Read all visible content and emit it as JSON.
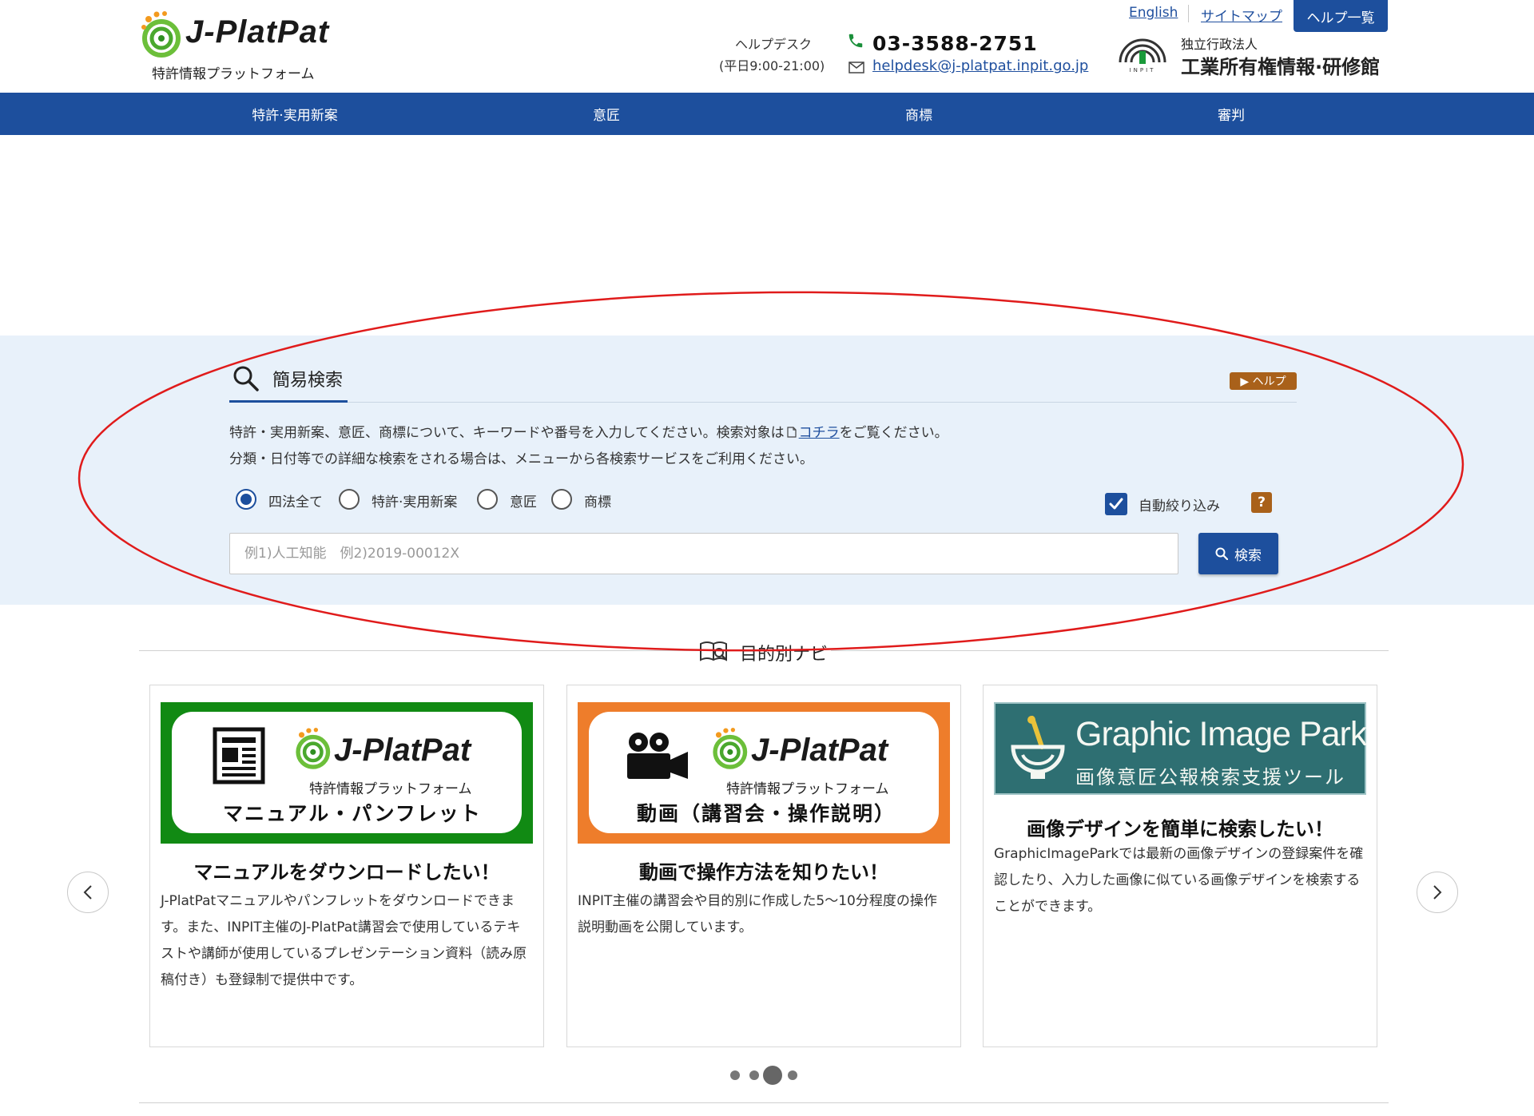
{
  "header": {
    "logo_text": "J-PlatPat",
    "logo_subtitle": "特許情報プラットフォーム",
    "helpdesk_label": "ヘルプデスク",
    "helpdesk_hours": "(平日9:00-21:00)",
    "phone": "03-3588-2751",
    "email": "helpdesk@j-platpat.inpit.go.jp",
    "links": {
      "english": "English",
      "sitemap": "サイトマップ",
      "help": "ヘルプ一覧"
    },
    "org_small": "独立行政法人",
    "org_name": "工業所有権情報·研修館",
    "org_mark_label": "INPIT"
  },
  "nav": {
    "items": [
      "特許·実用新案",
      "意匠",
      "商標",
      "審判"
    ]
  },
  "simple_search": {
    "title": "簡易検索",
    "help_label": "▶ ヘルプ",
    "desc1_before": "特許・実用新案、意匠、商標について、キーワードや番号を入力してください。検索対象は",
    "desc1_link": "コチラ",
    "desc1_after": "をご覧ください。",
    "desc2": "分類・日付等での詳細な検索をされる場合は、メニューから各検索サービスをご利用ください。",
    "radios": [
      {
        "label": "四法全て",
        "checked": true
      },
      {
        "label": "特許·実用新案",
        "checked": false
      },
      {
        "label": "意匠",
        "checked": false
      },
      {
        "label": "商標",
        "checked": false
      }
    ],
    "auto_filter_label": "自動絞り込み",
    "auto_filter_checked": true,
    "question_mark": "?",
    "input_placeholder": "例1)人工知能　例2)2019-00012X",
    "input_value": "",
    "search_button": "検索"
  },
  "navi": {
    "title": "目的別ナビ",
    "cards": [
      {
        "banner_logo": "J-PlatPat",
        "banner_sub": "特許情報プラットフォーム",
        "banner_caption": "マニュアル・パンフレット",
        "title": "マニュアルをダウンロードしたい！",
        "text": "J-PlatPatマニュアルやパンフレットをダウンロードできます。また、INPIT主催のJ-PlatPat講習会で使用しているテキストや講師が使用しているプレゼンテーション資料（読み原稿付き）も登録制で提供中です。"
      },
      {
        "banner_logo": "J-PlatPat",
        "banner_sub": "特許情報プラットフォーム",
        "banner_caption": "動画（講習会・操作説明）",
        "title": "動画で操作方法を知りたい！",
        "text": "INPIT主催の講習会や目的別に作成した5～10分程度の操作説明動画を公開しています。"
      },
      {
        "banner_title": "Graphic Image Park",
        "banner_sub": "画像意匠公報検索支援ツール",
        "title": "画像デザインを簡単に検索したい！",
        "text": "GraphicImageParkでは最新の画像デザインの登録案件を確認したり、入力した画像に似ている画像デザインを検索することができます。"
      }
    ],
    "active_dot": 3,
    "dot_count": 4
  },
  "colors": {
    "brand_blue": "#1d4f9d",
    "help_brown": "#a9611a",
    "search_band": "#e8f1fa",
    "annotation_red": "#e01b1b"
  }
}
